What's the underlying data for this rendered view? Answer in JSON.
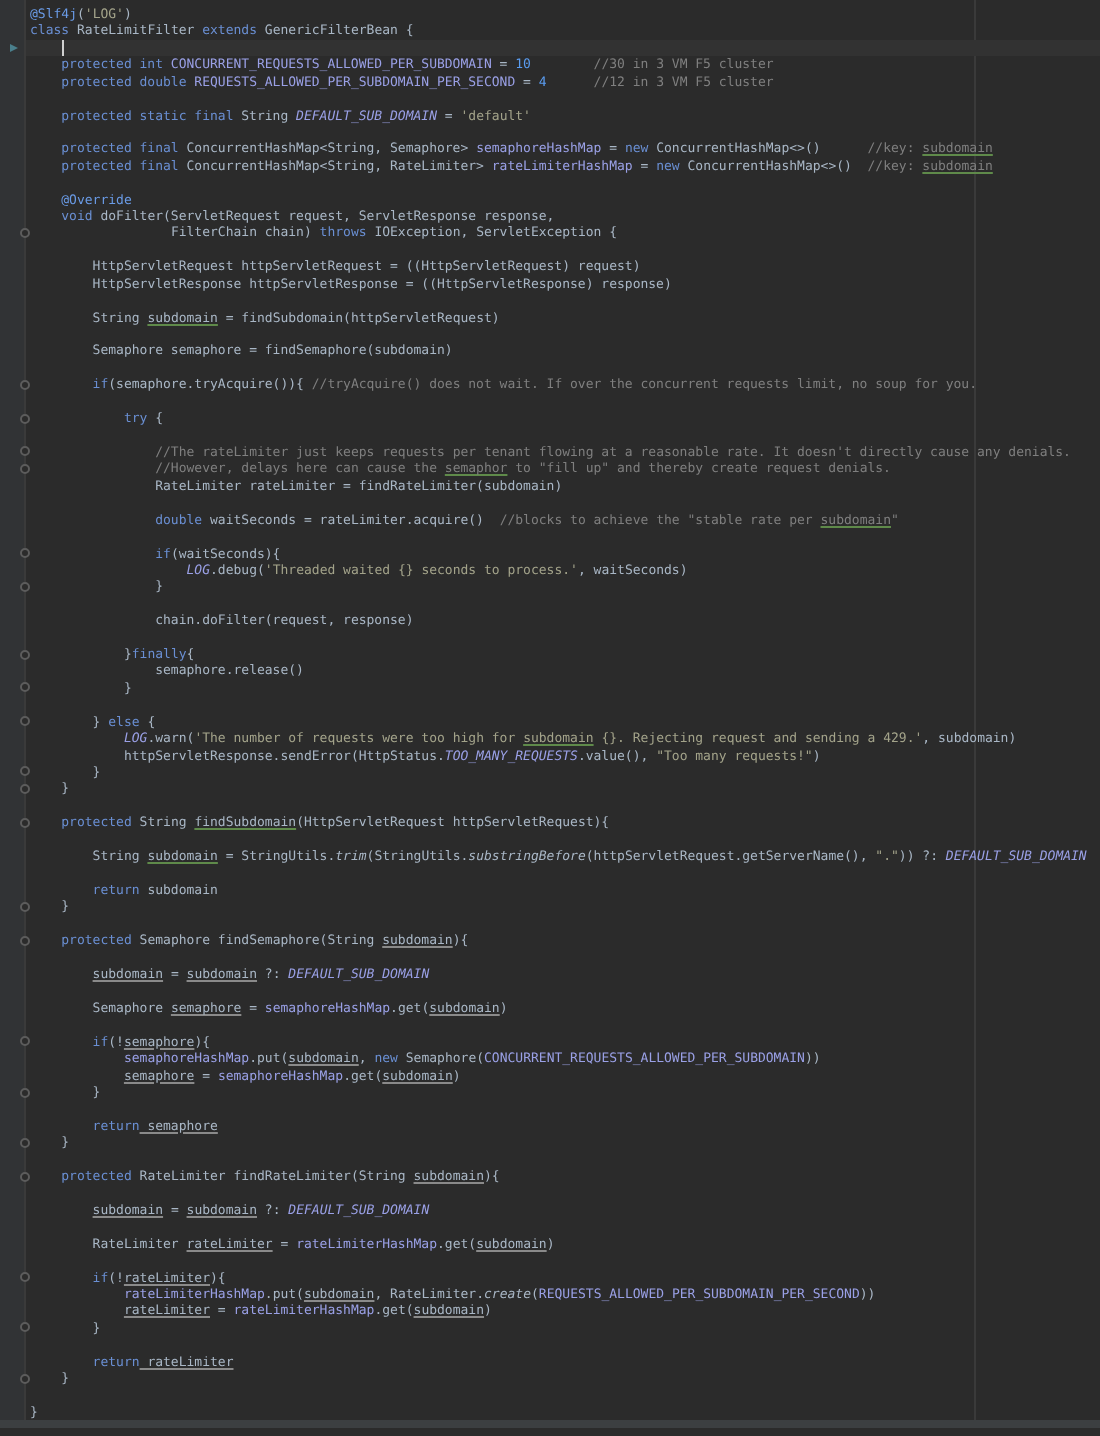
{
  "editor": {
    "lines": [
      {
        "fold": false,
        "current": false,
        "tokens": [
          {
            "kind": "annotation",
            "text": "@Slf4j"
          },
          {
            "kind": "plain",
            "text": "("
          },
          {
            "kind": "string",
            "text": "'LOG'"
          },
          {
            "kind": "plain",
            "text": ")"
          }
        ]
      },
      {
        "fold": false,
        "current": false,
        "tokens": [
          {
            "kind": "keyword",
            "text": "class"
          },
          {
            "kind": "plain",
            "text": " RateLimitFilter "
          },
          {
            "kind": "keyword",
            "text": "extends"
          },
          {
            "kind": "plain",
            "text": " GenericFilterBean {"
          }
        ]
      },
      {
        "fold": false,
        "current": true
      },
      {
        "fold": false,
        "current": false,
        "tokens": [
          {
            "kind": "keyword",
            "text": "    protected int"
          },
          {
            "kind": "field",
            "text": " CONCURRENT_REQUESTS_ALLOWED_PER_SUBDOMAIN"
          },
          {
            "kind": "plain",
            "text": " = "
          },
          {
            "kind": "number",
            "text": "10"
          },
          {
            "kind": "comment",
            "text": "        //30 in 3 VM F5 cluster"
          }
        ]
      },
      {
        "fold": false,
        "current": false,
        "tokens": [
          {
            "kind": "keyword",
            "text": "    protected double"
          },
          {
            "kind": "field",
            "text": " REQUESTS_ALLOWED_PER_SUBDOMAIN_PER_SECOND"
          },
          {
            "kind": "plain",
            "text": " = "
          },
          {
            "kind": "number",
            "text": "4"
          },
          {
            "kind": "comment",
            "text": "      //12 in 3 VM F5 cluster"
          }
        ]
      },
      {
        "fold": false,
        "current": false
      },
      {
        "fold": false,
        "current": false,
        "tokens": [
          {
            "kind": "keyword",
            "text": "    protected static final"
          },
          {
            "kind": "plain",
            "text": " String "
          },
          {
            "kind": "constant",
            "text": "DEFAULT_SUB_DOMAIN"
          },
          {
            "kind": "plain",
            "text": " = "
          },
          {
            "kind": "string",
            "text": "'default'"
          }
        ]
      },
      {
        "fold": false,
        "current": false
      },
      {
        "fold": false,
        "current": false,
        "tokens": [
          {
            "kind": "keyword",
            "text": "    protected final"
          },
          {
            "kind": "plain",
            "text": " ConcurrentHashMap<String, Semaphore> "
          },
          {
            "kind": "field",
            "text": "semaphoreHashMap"
          },
          {
            "kind": "plain",
            "text": " = "
          },
          {
            "kind": "keyword",
            "text": "new"
          },
          {
            "kind": "plain",
            "text": " ConcurrentHashMap<>()      "
          },
          {
            "kind": "comment",
            "text": "//key: "
          },
          {
            "kind": "comment_typo",
            "text": "subdomain"
          }
        ]
      },
      {
        "fold": false,
        "current": false,
        "tokens": [
          {
            "kind": "keyword",
            "text": "    protected final"
          },
          {
            "kind": "plain",
            "text": " ConcurrentHashMap<String, RateLimiter> "
          },
          {
            "kind": "field",
            "text": "rateLimiterHashMap"
          },
          {
            "kind": "plain",
            "text": " = "
          },
          {
            "kind": "keyword",
            "text": "new"
          },
          {
            "kind": "plain",
            "text": " ConcurrentHashMap<>()  "
          },
          {
            "kind": "comment",
            "text": "//key: "
          },
          {
            "kind": "comment_typo",
            "text": "subdomain"
          }
        ]
      },
      {
        "fold": false,
        "current": false
      },
      {
        "fold": false,
        "current": false,
        "tokens": [
          {
            "kind": "annotation",
            "text": "    @Override"
          }
        ]
      },
      {
        "fold": false,
        "current": false,
        "tokens": [
          {
            "kind": "keyword",
            "text": "    void"
          },
          {
            "kind": "plain",
            "text": " doFilter(ServletRequest request, ServletResponse response,"
          }
        ]
      },
      {
        "fold": true,
        "current": false,
        "tokens": [
          {
            "kind": "plain",
            "text": "                  FilterChain chain) "
          },
          {
            "kind": "keyword",
            "text": "throws"
          },
          {
            "kind": "plain",
            "text": " IOException, ServletException {"
          }
        ]
      },
      {
        "fold": false,
        "current": false
      },
      {
        "fold": false,
        "current": false,
        "tokens": [
          {
            "kind": "plain",
            "text": "        HttpServletRequest httpServletRequest = ((HttpServletRequest) request)"
          }
        ]
      },
      {
        "fold": false,
        "current": false,
        "tokens": [
          {
            "kind": "plain",
            "text": "        HttpServletResponse httpServletResponse = ((HttpServletResponse) response)"
          }
        ]
      },
      {
        "fold": false,
        "current": false
      },
      {
        "fold": false,
        "current": false,
        "tokens": [
          {
            "kind": "plain",
            "text": "        String "
          },
          {
            "kind": "typo",
            "text": "subdomain"
          },
          {
            "kind": "plain",
            "text": " = findSubdomain(httpServletRequest)"
          }
        ]
      },
      {
        "fold": false,
        "current": false
      },
      {
        "fold": false,
        "current": false,
        "tokens": [
          {
            "kind": "plain",
            "text": "        Semaphore semaphore = findSemaphore(subdomain)"
          }
        ]
      },
      {
        "fold": false,
        "current": false
      },
      {
        "fold": true,
        "current": false,
        "tokens": [
          {
            "kind": "keyword",
            "text": "        if"
          },
          {
            "kind": "plain",
            "text": "(semaphore.tryAcquire()){ "
          },
          {
            "kind": "comment",
            "text": "//tryAcquire() does not wait. If over the concurrent requests limit, no soup for you."
          }
        ]
      },
      {
        "fold": false,
        "current": false
      },
      {
        "fold": true,
        "current": false,
        "tokens": [
          {
            "kind": "keyword",
            "text": "            try"
          },
          {
            "kind": "plain",
            "text": " {"
          }
        ]
      },
      {
        "fold": false,
        "current": false
      },
      {
        "fold": true,
        "current": false,
        "tokens": [
          {
            "kind": "comment",
            "text": "                //The rateLimiter just keeps requests per tenant flowing at a reasonable rate. It doesn't directly cause any denials."
          }
        ]
      },
      {
        "fold": true,
        "current": false,
        "tokens": [
          {
            "kind": "comment",
            "text": "                //However, delays here can cause the "
          },
          {
            "kind": "comment_typo",
            "text": "semaphor"
          },
          {
            "kind": "comment",
            "text": " to \"fill up\" and thereby create request denials."
          }
        ]
      },
      {
        "fold": false,
        "current": false,
        "tokens": [
          {
            "kind": "plain",
            "text": "                RateLimiter rateLimiter = findRateLimiter(subdomain)"
          }
        ]
      },
      {
        "fold": false,
        "current": false
      },
      {
        "fold": false,
        "current": false,
        "tokens": [
          {
            "kind": "keyword",
            "text": "                double"
          },
          {
            "kind": "plain",
            "text": " waitSeconds = rateLimiter.acquire()  "
          },
          {
            "kind": "comment",
            "text": "//blocks to achieve the \"stable rate per "
          },
          {
            "kind": "comment_typo",
            "text": "subdomain"
          },
          {
            "kind": "comment",
            "text": "\""
          }
        ]
      },
      {
        "fold": false,
        "current": false
      },
      {
        "fold": true,
        "current": false,
        "tokens": [
          {
            "kind": "keyword",
            "text": "                if"
          },
          {
            "kind": "plain",
            "text": "(waitSeconds){"
          }
        ]
      },
      {
        "fold": false,
        "current": false,
        "tokens": [
          {
            "kind": "constant",
            "text": "                    LOG"
          },
          {
            "kind": "plain",
            "text": ".debug("
          },
          {
            "kind": "string",
            "text": "'Threaded waited {} seconds to process.'"
          },
          {
            "kind": "plain",
            "text": ", waitSeconds)"
          }
        ]
      },
      {
        "fold": true,
        "current": false,
        "tokens": [
          {
            "kind": "plain",
            "text": "                }"
          }
        ]
      },
      {
        "fold": false,
        "current": false
      },
      {
        "fold": false,
        "current": false,
        "tokens": [
          {
            "kind": "plain",
            "text": "                chain.doFilter(request, response)"
          }
        ]
      },
      {
        "fold": false,
        "current": false
      },
      {
        "fold": true,
        "current": false,
        "tokens": [
          {
            "kind": "plain",
            "text": "            }"
          },
          {
            "kind": "keyword",
            "text": "finally"
          },
          {
            "kind": "plain",
            "text": "{"
          }
        ]
      },
      {
        "fold": false,
        "current": false,
        "tokens": [
          {
            "kind": "plain",
            "text": "                semaphore.release()"
          }
        ]
      },
      {
        "fold": true,
        "current": false,
        "tokens": [
          {
            "kind": "plain",
            "text": "            }"
          }
        ]
      },
      {
        "fold": false,
        "current": false
      },
      {
        "fold": true,
        "current": false,
        "tokens": [
          {
            "kind": "plain",
            "text": "        } "
          },
          {
            "kind": "keyword",
            "text": "else"
          },
          {
            "kind": "plain",
            "text": " {"
          }
        ]
      },
      {
        "fold": false,
        "current": false,
        "tokens": [
          {
            "kind": "constant",
            "text": "            LOG"
          },
          {
            "kind": "plain",
            "text": ".warn("
          },
          {
            "kind": "string",
            "text": "'The number of requests were too high for "
          },
          {
            "kind": "string_typo",
            "text": "subdomain"
          },
          {
            "kind": "string",
            "text": " {}. Rejecting request and sending a 429.'"
          },
          {
            "kind": "plain",
            "text": ", subdomain)"
          }
        ]
      },
      {
        "fold": false,
        "current": false,
        "tokens": [
          {
            "kind": "plain",
            "text": "            httpServletResponse.sendError(HttpStatus."
          },
          {
            "kind": "constant",
            "text": "TOO_MANY_REQUESTS"
          },
          {
            "kind": "plain",
            "text": ".value(), "
          },
          {
            "kind": "string",
            "text": "\"Too many requests!\""
          },
          {
            "kind": "plain",
            "text": ")"
          }
        ]
      },
      {
        "fold": true,
        "current": false,
        "tokens": [
          {
            "kind": "plain",
            "text": "        }"
          }
        ]
      },
      {
        "fold": true,
        "current": false,
        "tokens": [
          {
            "kind": "plain",
            "text": "    }"
          }
        ]
      },
      {
        "fold": false,
        "current": false
      },
      {
        "fold": true,
        "current": false,
        "tokens": [
          {
            "kind": "keyword",
            "text": "    protected"
          },
          {
            "kind": "plain",
            "text": " String "
          },
          {
            "kind": "typo",
            "text": "findSubdomain"
          },
          {
            "kind": "plain",
            "text": "(HttpServletRequest httpServletRequest){"
          }
        ]
      },
      {
        "fold": false,
        "current": false
      },
      {
        "fold": false,
        "current": false,
        "tokens": [
          {
            "kind": "plain",
            "text": "        String "
          },
          {
            "kind": "typo",
            "text": "subdomain"
          },
          {
            "kind": "plain",
            "text": " = StringUtils."
          },
          {
            "kind": "static",
            "text": "trim"
          },
          {
            "kind": "plain",
            "text": "(StringUtils."
          },
          {
            "kind": "static",
            "text": "substringBefore"
          },
          {
            "kind": "plain",
            "text": "(httpServletRequest.getServerName(), "
          },
          {
            "kind": "string",
            "text": "\".\""
          },
          {
            "kind": "plain",
            "text": ")) ?: "
          },
          {
            "kind": "constant",
            "text": "DEFAULT_SUB_DOMAIN"
          }
        ]
      },
      {
        "fold": false,
        "current": false
      },
      {
        "fold": false,
        "current": false,
        "tokens": [
          {
            "kind": "keyword",
            "text": "        return"
          },
          {
            "kind": "plain",
            "text": " subdomain"
          }
        ]
      },
      {
        "fold": true,
        "current": false,
        "tokens": [
          {
            "kind": "plain",
            "text": "    }"
          }
        ]
      },
      {
        "fold": false,
        "current": false
      },
      {
        "fold": true,
        "current": false,
        "tokens": [
          {
            "kind": "keyword",
            "text": "    protected"
          },
          {
            "kind": "plain",
            "text": " Semaphore findSemaphore(String "
          },
          {
            "kind": "local",
            "text": "subdomain"
          },
          {
            "kind": "plain",
            "text": "){"
          }
        ]
      },
      {
        "fold": false,
        "current": false
      },
      {
        "fold": false,
        "current": false,
        "tokens": [
          {
            "kind": "local",
            "text": "        subdomain"
          },
          {
            "kind": "plain",
            "text": " = "
          },
          {
            "kind": "local",
            "text": "subdomain"
          },
          {
            "kind": "plain",
            "text": " ?: "
          },
          {
            "kind": "constant",
            "text": "DEFAULT_SUB_DOMAIN"
          }
        ]
      },
      {
        "fold": false,
        "current": false
      },
      {
        "fold": false,
        "current": false,
        "tokens": [
          {
            "kind": "plain",
            "text": "        Semaphore "
          },
          {
            "kind": "local",
            "text": "semaphore"
          },
          {
            "kind": "plain",
            "text": " = "
          },
          {
            "kind": "field",
            "text": "semaphoreHashMap"
          },
          {
            "kind": "plain",
            "text": ".get("
          },
          {
            "kind": "local",
            "text": "subdomain"
          },
          {
            "kind": "plain",
            "text": ")"
          }
        ]
      },
      {
        "fold": false,
        "current": false
      },
      {
        "fold": true,
        "current": false,
        "tokens": [
          {
            "kind": "keyword",
            "text": "        if"
          },
          {
            "kind": "plain",
            "text": "(!"
          },
          {
            "kind": "local",
            "text": "semaphore"
          },
          {
            "kind": "plain",
            "text": "){"
          }
        ]
      },
      {
        "fold": false,
        "current": false,
        "tokens": [
          {
            "kind": "field",
            "text": "            semaphoreHashMap"
          },
          {
            "kind": "plain",
            "text": ".put("
          },
          {
            "kind": "local",
            "text": "subdomain"
          },
          {
            "kind": "plain",
            "text": ", "
          },
          {
            "kind": "keyword",
            "text": "new"
          },
          {
            "kind": "plain",
            "text": " Semaphore("
          },
          {
            "kind": "field",
            "text": "CONCURRENT_REQUESTS_ALLOWED_PER_SUBDOMAIN"
          },
          {
            "kind": "plain",
            "text": "))"
          }
        ]
      },
      {
        "fold": false,
        "current": false,
        "tokens": [
          {
            "kind": "local",
            "text": "            semaphore"
          },
          {
            "kind": "plain",
            "text": " = "
          },
          {
            "kind": "field",
            "text": "semaphoreHashMap"
          },
          {
            "kind": "plain",
            "text": ".get("
          },
          {
            "kind": "local",
            "text": "subdomain"
          },
          {
            "kind": "plain",
            "text": ")"
          }
        ]
      },
      {
        "fold": true,
        "current": false,
        "tokens": [
          {
            "kind": "plain",
            "text": "        }"
          }
        ]
      },
      {
        "fold": false,
        "current": false
      },
      {
        "fold": false,
        "current": false,
        "tokens": [
          {
            "kind": "keyword",
            "text": "        return"
          },
          {
            "kind": "local",
            "text": " semaphore"
          }
        ]
      },
      {
        "fold": true,
        "current": false,
        "tokens": [
          {
            "kind": "plain",
            "text": "    }"
          }
        ]
      },
      {
        "fold": false,
        "current": false
      },
      {
        "fold": true,
        "current": false,
        "tokens": [
          {
            "kind": "keyword",
            "text": "    protected"
          },
          {
            "kind": "plain",
            "text": " RateLimiter findRateLimiter(String "
          },
          {
            "kind": "local",
            "text": "subdomain"
          },
          {
            "kind": "plain",
            "text": "){"
          }
        ]
      },
      {
        "fold": false,
        "current": false
      },
      {
        "fold": false,
        "current": false,
        "tokens": [
          {
            "kind": "local",
            "text": "        subdomain"
          },
          {
            "kind": "plain",
            "text": " = "
          },
          {
            "kind": "local",
            "text": "subdomain"
          },
          {
            "kind": "plain",
            "text": " ?: "
          },
          {
            "kind": "constant",
            "text": "DEFAULT_SUB_DOMAIN"
          }
        ]
      },
      {
        "fold": false,
        "current": false
      },
      {
        "fold": false,
        "current": false,
        "tokens": [
          {
            "kind": "plain",
            "text": "        RateLimiter "
          },
          {
            "kind": "local",
            "text": "rateLimiter"
          },
          {
            "kind": "plain",
            "text": " = "
          },
          {
            "kind": "field",
            "text": "rateLimiterHashMap"
          },
          {
            "kind": "plain",
            "text": ".get("
          },
          {
            "kind": "local",
            "text": "subdomain"
          },
          {
            "kind": "plain",
            "text": ")"
          }
        ]
      },
      {
        "fold": false,
        "current": false
      },
      {
        "fold": true,
        "current": false,
        "tokens": [
          {
            "kind": "keyword",
            "text": "        if"
          },
          {
            "kind": "plain",
            "text": "(!"
          },
          {
            "kind": "local",
            "text": "rateLimiter"
          },
          {
            "kind": "plain",
            "text": "){"
          }
        ]
      },
      {
        "fold": false,
        "current": false,
        "tokens": [
          {
            "kind": "field",
            "text": "            rateLimiterHashMap"
          },
          {
            "kind": "plain",
            "text": ".put("
          },
          {
            "kind": "local",
            "text": "subdomain"
          },
          {
            "kind": "plain",
            "text": ", RateLimiter."
          },
          {
            "kind": "static",
            "text": "create"
          },
          {
            "kind": "plain",
            "text": "("
          },
          {
            "kind": "field",
            "text": "REQUESTS_ALLOWED_PER_SUBDOMAIN_PER_SECOND"
          },
          {
            "kind": "plain",
            "text": "))"
          }
        ]
      },
      {
        "fold": false,
        "current": false,
        "tokens": [
          {
            "kind": "local",
            "text": "            rateLimiter"
          },
          {
            "kind": "plain",
            "text": " = "
          },
          {
            "kind": "field",
            "text": "rateLimiterHashMap"
          },
          {
            "kind": "plain",
            "text": ".get("
          },
          {
            "kind": "local",
            "text": "subdomain"
          },
          {
            "kind": "plain",
            "text": ")"
          }
        ]
      },
      {
        "fold": true,
        "current": false,
        "tokens": [
          {
            "kind": "plain",
            "text": "        }"
          }
        ]
      },
      {
        "fold": false,
        "current": false
      },
      {
        "fold": false,
        "current": false,
        "tokens": [
          {
            "kind": "keyword",
            "text": "        return"
          },
          {
            "kind": "local",
            "text": " rateLimiter"
          }
        ]
      },
      {
        "fold": true,
        "current": false,
        "tokens": [
          {
            "kind": "plain",
            "text": "    }"
          }
        ]
      },
      {
        "fold": false,
        "current": false
      },
      {
        "fold": false,
        "current": false,
        "tokens": [
          {
            "kind": "plain",
            "text": "}"
          }
        ]
      }
    ]
  }
}
